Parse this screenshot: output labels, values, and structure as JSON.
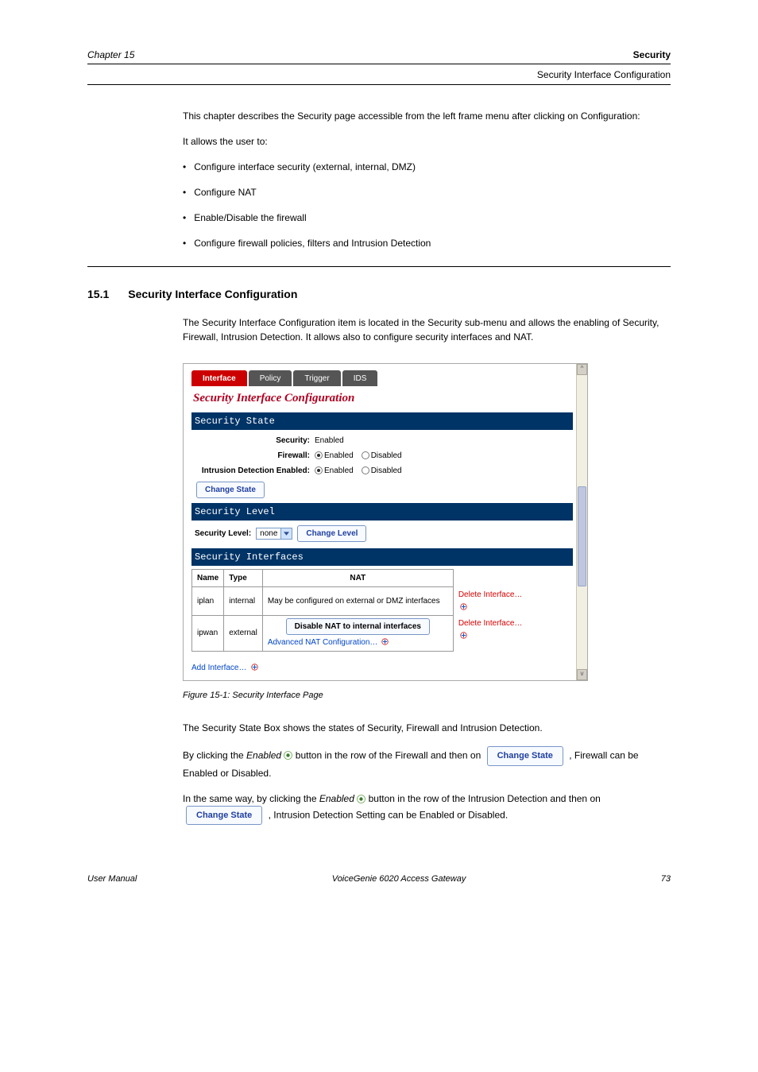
{
  "header": {
    "chapter": "Chapter 15",
    "title": "Security",
    "sub": "Security Interface Configuration"
  },
  "intro": {
    "p1": "This chapter describes the Security page accessible from the left frame menu after clicking on Configuration:",
    "p2": "It allows the user to:",
    "b1": "Configure interface security (external, internal, DMZ)",
    "b2": "Configure NAT",
    "b3": "Enable/Disable the firewall",
    "b4": "Configure firewall policies, filters and Intrusion Detection"
  },
  "sec15_1": {
    "num": "15.1",
    "title": "Security Interface Configuration",
    "desc": "The Security Interface Configuration item is located in the Security sub-menu and allows the enabling of Security, Firewall, Intrusion Detection. It allows also to configure security interfaces and NAT."
  },
  "fig": {
    "tabs": {
      "interface": "Interface",
      "policy": "Policy",
      "trigger": "Trigger",
      "ids": "IDS"
    },
    "title": "Security Interface Configuration",
    "sect_state": "Security State",
    "security_label": "Security:",
    "security_value": "Enabled",
    "firewall_label": "Firewall:",
    "ids_label": "Intrusion Detection Enabled:",
    "enabled": "Enabled",
    "disabled": "Disabled",
    "change_state": "Change State",
    "sect_level": "Security Level",
    "level_label": "Security Level:",
    "level_value": "none",
    "change_level": "Change Level",
    "sect_if": "Security Interfaces",
    "th_name": "Name",
    "th_type": "Type",
    "th_nat": "NAT",
    "row1_name": "iplan",
    "row1_type": "internal",
    "row1_nat": "May be configured on external or DMZ interfaces",
    "row2_name": "ipwan",
    "row2_type": "external",
    "row2_btn": "Disable NAT to internal interfaces",
    "row2_link": "Advanced NAT Configuration…",
    "del": "Delete Interface…",
    "add": "Add Interface…"
  },
  "caption1": "Figure 15-1: Security Interface Page",
  "p_state1": "The Security State Box shows the states of Security, Firewall and Intrusion Detection.",
  "p_state2_a": "By clicking the ",
  "p_state2_b": " button in the row of the Firewall and then on ",
  "p_state2_c": ", Firewall can be Enabled or Disabled.",
  "enabled_word": "Enabled",
  "p_state3_a": "In the same way, by clicking the ",
  "p_state3_b": " button in the row of the Intrusion Detection and then on ",
  "p_state3_c": ", Intrusion Detection Setting can be Enabled or Disabled.",
  "change_state_btn": "Change State",
  "footer": {
    "left": "User Manual",
    "center": "VoiceGenie 6020 Access Gateway",
    "right": "73"
  }
}
